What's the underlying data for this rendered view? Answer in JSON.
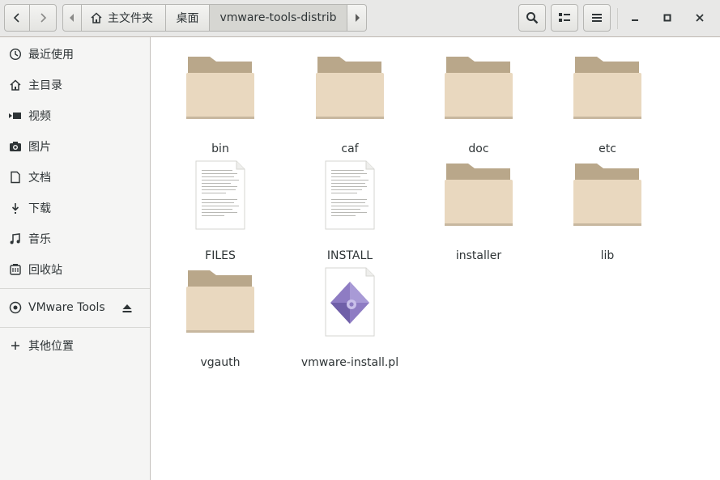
{
  "toolbar": {
    "path": [
      "主文件夹",
      "桌面",
      "vmware-tools-distrib"
    ]
  },
  "icons": {
    "back": "chevron-left-icon",
    "forward": "chevron-right-icon",
    "home": "home-icon",
    "search": "search-icon",
    "view": "list-view-icon",
    "menu": "hamburger-menu-icon",
    "minimize": "minimize-icon",
    "maximize": "maximize-icon",
    "close": "close-icon"
  },
  "sidebar": {
    "items": [
      {
        "label": "最近使用",
        "icon": "clock-icon"
      },
      {
        "label": "主目录",
        "icon": "home-icon"
      },
      {
        "label": "视频",
        "icon": "video-icon"
      },
      {
        "label": "图片",
        "icon": "camera-icon"
      },
      {
        "label": "文档",
        "icon": "document-icon"
      },
      {
        "label": "下载",
        "icon": "download-icon"
      },
      {
        "label": "音乐",
        "icon": "music-icon"
      },
      {
        "label": "回收站",
        "icon": "trash-icon"
      }
    ],
    "devices": [
      {
        "label": "VMware Tools",
        "icon": "disc-icon",
        "eject_icon": "eject-icon"
      }
    ],
    "other": {
      "label": "其他位置",
      "icon": "plus-icon"
    }
  },
  "files": [
    {
      "name": "bin",
      "type": "folder"
    },
    {
      "name": "caf",
      "type": "folder"
    },
    {
      "name": "doc",
      "type": "folder"
    },
    {
      "name": "etc",
      "type": "folder"
    },
    {
      "name": "FILES",
      "type": "text"
    },
    {
      "name": "INSTALL",
      "type": "text"
    },
    {
      "name": "installer",
      "type": "folder"
    },
    {
      "name": "lib",
      "type": "folder"
    },
    {
      "name": "vgauth",
      "type": "folder"
    },
    {
      "name": "vmware-install.pl",
      "type": "script"
    }
  ],
  "colors": {
    "folder_back": "#b9a78a",
    "folder_front": "#e9d8bf",
    "script_accent": "#8e7cc3"
  }
}
